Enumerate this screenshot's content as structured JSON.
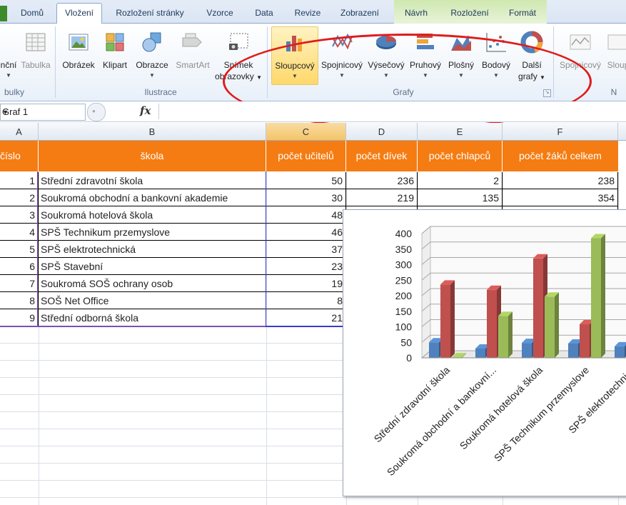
{
  "ribbon": {
    "tabs": [
      "Domů",
      "Vložení",
      "Rozložení stránky",
      "Vzorce",
      "Data",
      "Revize",
      "Zobrazení",
      "Návrh",
      "Rozložení",
      "Formát"
    ],
    "active_tab": "Vložení",
    "tables_group": {
      "label": "bulky",
      "buttons": [
        "nční",
        "Tabulka"
      ]
    },
    "illustrations_group": {
      "label": "Ilustrace",
      "buttons": [
        "Obrázek",
        "Klipart",
        "Obrazce",
        "SmartArt"
      ],
      "screenshot_button": [
        "Snímek",
        "obrazovky"
      ]
    },
    "charts_group": {
      "label": "Grafy",
      "buttons": [
        "Sloupcový",
        "Spojnicový",
        "Výsečový",
        "Pruhový",
        "Plošný",
        "Bodový"
      ],
      "more_button": [
        "Další",
        "grafy"
      ]
    },
    "sparklines": {
      "buttons": [
        "Spojnicový",
        "Sloup"
      ],
      "label": "N"
    },
    "colors": {
      "accent_red": "#e01b1b",
      "header_orange": "#f57c12"
    }
  },
  "formula_bar": {
    "name_box": "Graf 1",
    "fx_symbol": "fx",
    "formula": ""
  },
  "sheet": {
    "columns": [
      "A",
      "B",
      "C",
      "D",
      "E",
      "F"
    ],
    "header": [
      "číslo",
      "škola",
      "počet učitelů",
      "počet dívek",
      "počet chlapců",
      "počet žáků celkem"
    ],
    "rows": [
      {
        "n": "1",
        "school": "Střední zdravotní škola",
        "ucitele": "50",
        "divky": "236",
        "chlapci": "2",
        "celkem": "238"
      },
      {
        "n": "2",
        "school": "Soukromá obchodní a bankovní akademie",
        "ucitele": "30",
        "divky": "219",
        "chlapci": "135",
        "celkem": "354"
      },
      {
        "n": "3",
        "school": "Soukromá hotelová škola",
        "ucitele": "48"
      },
      {
        "n": "4",
        "school": "SPŠ Technikum przemyslove",
        "ucitele": "46"
      },
      {
        "n": "5",
        "school": "SPŠ elektrotechnická",
        "ucitele": "37"
      },
      {
        "n": "6",
        "school": "SPŠ Stavební",
        "ucitele": "23"
      },
      {
        "n": "7",
        "school": "Soukromá SOŠ ochrany osob",
        "ucitele": "19"
      },
      {
        "n": "8",
        "school": "SOŠ Net Office",
        "ucitele": "8"
      },
      {
        "n": "9",
        "school": "Střední odborná škola",
        "ucitele": "21"
      }
    ]
  },
  "chart_data": {
    "type": "bar",
    "categories": [
      "Střední zdravotní škola",
      "Soukromá obchodní a bankovní...",
      "Soukromá hotelová škola",
      "SPŠ Technikum przemyslove",
      "SPŠ elektrotechnick"
    ],
    "series": [
      {
        "values": [
          50,
          30,
          48,
          46,
          37
        ],
        "color": "#4f81bd"
      },
      {
        "values": [
          236,
          219,
          320,
          108,
          null
        ],
        "color": "#c0504d"
      },
      {
        "values": [
          2,
          135,
          197,
          385,
          null
        ],
        "color": "#9bbb59"
      }
    ],
    "yticks": [
      "0",
      "50",
      "100",
      "150",
      "200",
      "250",
      "300",
      "350",
      "400"
    ],
    "ylim": [
      0,
      400
    ],
    "grid": true,
    "style": "3d-clustered-column"
  }
}
